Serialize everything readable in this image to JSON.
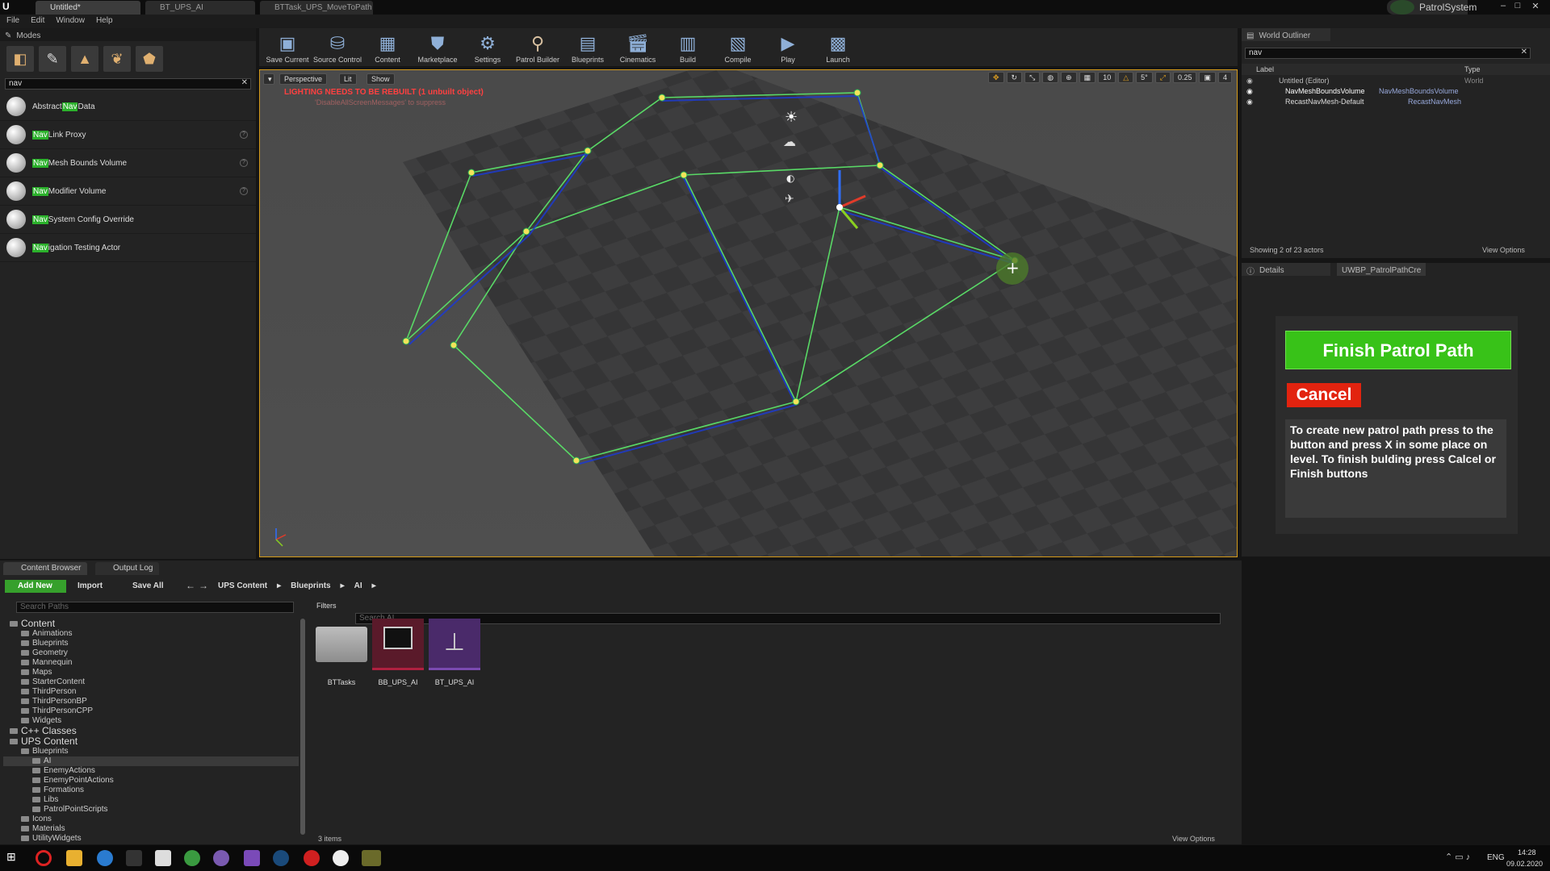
{
  "titlebar": {
    "tabs": [
      "Untitled*",
      "BT_UPS_AI",
      "BTTask_UPS_MoveToPath"
    ],
    "project": "PatrolSystem"
  },
  "menu": [
    "File",
    "Edit",
    "Window",
    "Help"
  ],
  "modes": {
    "title": "Modes",
    "search": "nav",
    "items": [
      {
        "pre": "Abstract ",
        "hl": "Nav",
        "post": " Data"
      },
      {
        "pre": "",
        "hl": "Nav",
        "post": " Link Proxy"
      },
      {
        "pre": "",
        "hl": "Nav",
        "post": " Mesh Bounds Volume"
      },
      {
        "pre": "",
        "hl": "Nav",
        "post": " Modifier Volume"
      },
      {
        "pre": "",
        "hl": "Nav",
        "post": " System Config Override"
      },
      {
        "pre": "",
        "hl": "Nav",
        "post": "igation Testing Actor"
      }
    ]
  },
  "toolbar": [
    "Save Current",
    "Source Control",
    "Content",
    "Marketplace",
    "Settings",
    "Patrol Builder",
    "Blueprints",
    "Cinematics",
    "Build",
    "Compile",
    "Play",
    "Launch"
  ],
  "viewport": {
    "perspective": "Perspective",
    "lit": "Lit",
    "show": "Show",
    "warning": "LIGHTING NEEDS TO BE REBUILT (1 unbuilt object)",
    "suppress": "'DisableAllScreenMessages' to suppress",
    "grid": "10",
    "angle": "5°",
    "scale": "0.25",
    "cams": "4"
  },
  "outliner": {
    "title": "World Outliner",
    "search": "nav",
    "col_label": "Label",
    "col_type": "Type",
    "rows": [
      {
        "label": "Untitled (Editor)",
        "type": "World"
      },
      {
        "label": "NavMeshBoundsVolume",
        "type": "NavMeshBoundsVolume"
      },
      {
        "label": "RecastNavMesh-Default",
        "type": "RecastNavMesh"
      }
    ],
    "showing": "Showing 2 of 23 actors",
    "view_options": "View Options"
  },
  "details": {
    "tab1": "Details",
    "tab2": "UWBP_PatrolPathCre",
    "finish": "Finish Patrol Path",
    "cancel": "Cancel",
    "help": "To create new patrol path press to the button and press X in some place on level. To finish bulding press Calcel or Finish buttons"
  },
  "content_browser": {
    "tab1": "Content Browser",
    "tab2": "Output Log",
    "add_new": "Add New",
    "import": "Import",
    "save_all": "Save All",
    "breadcrumb": [
      "UPS Content",
      "Blueprints",
      "AI"
    ],
    "search_paths": "Search Paths",
    "filters": "Filters",
    "search_assets": "Search AI",
    "tree": [
      {
        "t": "Content",
        "d": 0,
        "big": true
      },
      {
        "t": "Animations",
        "d": 1
      },
      {
        "t": "Blueprints",
        "d": 1
      },
      {
        "t": "Geometry",
        "d": 1
      },
      {
        "t": "Mannequin",
        "d": 1
      },
      {
        "t": "Maps",
        "d": 1
      },
      {
        "t": "StarterContent",
        "d": 1
      },
      {
        "t": "ThirdPerson",
        "d": 1
      },
      {
        "t": "ThirdPersonBP",
        "d": 1
      },
      {
        "t": "ThirdPersonCPP",
        "d": 1
      },
      {
        "t": "Widgets",
        "d": 1
      },
      {
        "t": "C++ Classes",
        "d": 0,
        "big": true
      },
      {
        "t": "UPS Content",
        "d": 0,
        "big": true
      },
      {
        "t": "Blueprints",
        "d": 1
      },
      {
        "t": "AI",
        "d": 2,
        "sel": true
      },
      {
        "t": "EnemyActions",
        "d": 2
      },
      {
        "t": "EnemyPointActions",
        "d": 2
      },
      {
        "t": "Formations",
        "d": 2
      },
      {
        "t": "Libs",
        "d": 2
      },
      {
        "t": "PatrolPointScripts",
        "d": 2
      },
      {
        "t": "Icons",
        "d": 1
      },
      {
        "t": "Materials",
        "d": 1
      },
      {
        "t": "UtilityWidgets",
        "d": 1
      }
    ],
    "assets": [
      "BTTasks",
      "BB_UPS_AI",
      "BT_UPS_AI"
    ],
    "count": "3 items",
    "view_options": "View Options"
  },
  "taskbar": {
    "lang": "ENG",
    "time": "14:28",
    "date": "09.02.2020"
  },
  "colors": {
    "accent": "#d49a1a",
    "finish": "#38c218",
    "cancel": "#e2230f",
    "highlight": "#2bb12b"
  }
}
